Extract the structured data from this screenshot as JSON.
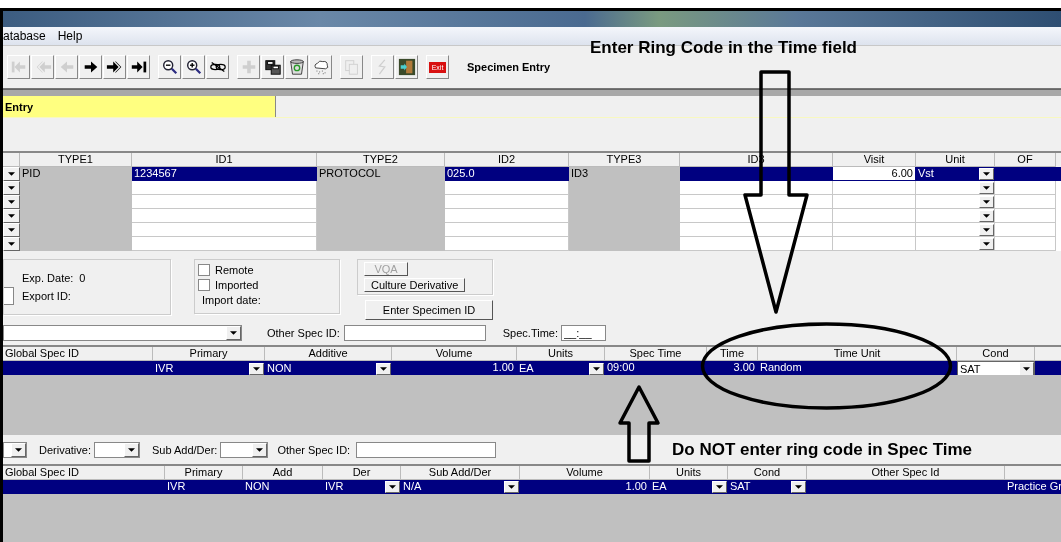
{
  "menu": [
    {
      "label": "atabase"
    },
    {
      "label": "Help"
    }
  ],
  "toolbar_groups": [
    {
      "buttons": [
        {
          "kind": "first",
          "disabled": true
        },
        {
          "kind": "prev-fast",
          "disabled": true
        },
        {
          "kind": "prev",
          "disabled": true
        },
        {
          "kind": "next",
          "disabled": false
        },
        {
          "kind": "next-fast",
          "disabled": false
        },
        {
          "kind": "last",
          "disabled": false
        }
      ]
    },
    {
      "buttons": [
        {
          "kind": "zoom-out",
          "disabled": false
        },
        {
          "kind": "zoom-in",
          "disabled": false
        },
        {
          "kind": "unlink",
          "disabled": false
        }
      ]
    },
    {
      "buttons": [
        {
          "kind": "add",
          "disabled": true
        },
        {
          "kind": "save-copy",
          "disabled": false
        },
        {
          "kind": "recycle",
          "disabled": false
        },
        {
          "kind": "weather",
          "disabled": false
        }
      ]
    },
    {
      "buttons": [
        {
          "kind": "copy",
          "disabled": true
        }
      ]
    },
    {
      "buttons": [
        {
          "kind": "lightning",
          "disabled": true
        },
        {
          "kind": "door",
          "disabled": false
        }
      ]
    },
    {
      "buttons": [
        {
          "kind": "exit",
          "label": "Exit",
          "disabled": false
        }
      ]
    }
  ],
  "toolbar_title": "Specimen Entry",
  "tab": {
    "label": "Entry",
    "selected": true
  },
  "id_grid": {
    "columns": [
      {
        "label": "TYPE1",
        "kind": "readonly"
      },
      {
        "label": "ID1",
        "kind": "text"
      },
      {
        "label": "TYPE2",
        "kind": "readonly"
      },
      {
        "label": "ID2",
        "kind": "text"
      },
      {
        "label": "TYPE3",
        "kind": "readonly"
      },
      {
        "label": "ID3",
        "kind": "text"
      },
      {
        "label": "Visit",
        "kind": "field"
      },
      {
        "label": "Unit",
        "kind": "dropdown"
      },
      {
        "label": "OF",
        "kind": "text"
      }
    ],
    "rows": [
      {
        "selected": true,
        "cells": [
          "PID",
          "1234567",
          "PROTOCOL",
          "025.0",
          "ID3",
          null,
          "6.00",
          "Vst",
          null
        ]
      },
      {
        "selected": false
      },
      {
        "selected": false
      },
      {
        "selected": false
      },
      {
        "selected": false
      },
      {
        "selected": false
      }
    ]
  },
  "export_box": {
    "exp_date_label": "Exp. Date:",
    "exp_date_value": "0",
    "export_id_label": "Export ID:"
  },
  "import_box": {
    "checkboxes": [
      {
        "label": "Remote",
        "checked": false
      },
      {
        "label": "Imported",
        "checked": false
      }
    ],
    "import_date_label": "Import date:"
  },
  "buttons": [
    {
      "label": "VQA",
      "disabled": true
    },
    {
      "label": "Culture Derivative",
      "disabled": false
    },
    {
      "label": "Enter Specimen ID",
      "disabled": false
    }
  ],
  "spec_filter": {
    "other_spec_label": "Other Spec ID:",
    "spec_time_label": "Spec.Time:",
    "spec_time_placeholder": "__:__"
  },
  "spec_grid": {
    "columns": [
      {
        "label": "Global Spec ID",
        "kind": "text"
      },
      {
        "label": "Primary",
        "kind": "dropdown"
      },
      {
        "label": "Additive",
        "kind": "dropdown"
      },
      {
        "label": "Volume",
        "kind": "number"
      },
      {
        "label": "Units",
        "kind": "dropdown"
      },
      {
        "label": "Spec Time",
        "kind": "text"
      },
      {
        "label": "Time",
        "kind": "number"
      },
      {
        "label": "Time Unit",
        "kind": "text"
      },
      {
        "label": "Cond",
        "kind": "combo"
      },
      {
        "kind": "text"
      }
    ],
    "rows": [
      {
        "selected": true,
        "cells": [
          null,
          "IVR",
          "NON",
          "1.00",
          "EA",
          "09:00",
          "3.00",
          "Random",
          "SAT",
          null
        ]
      }
    ]
  },
  "derivative_bar": {
    "derivative_label": "Derivative:",
    "sub_add_label": "Sub Add/Der:",
    "other_spec_label": "Other Spec ID:"
  },
  "derivative_grid": {
    "columns": [
      {
        "label": "Global Spec ID",
        "kind": "text"
      },
      {
        "label": "Primary",
        "kind": "text"
      },
      {
        "label": "Add",
        "kind": "text"
      },
      {
        "label": "Der",
        "kind": "dropdown"
      },
      {
        "label": "Sub Add/Der",
        "kind": "dropdown"
      },
      {
        "label": "Volume",
        "kind": "number"
      },
      {
        "label": "Units",
        "kind": "dropdown"
      },
      {
        "label": "Cond",
        "kind": "dropdown"
      },
      {
        "label": "Other Spec Id",
        "kind": "text"
      },
      {
        "kind": "text"
      }
    ],
    "rows": [
      {
        "selected": true,
        "cells": [
          null,
          "IVR",
          "NON",
          "IVR",
          "N/A",
          "1.00",
          "EA",
          "SAT",
          null,
          "Practice Gr"
        ]
      }
    ]
  },
  "notes": {
    "top": "Enter Ring Code in the Time field",
    "bottom": "Do NOT enter ring code in Spec Time"
  }
}
